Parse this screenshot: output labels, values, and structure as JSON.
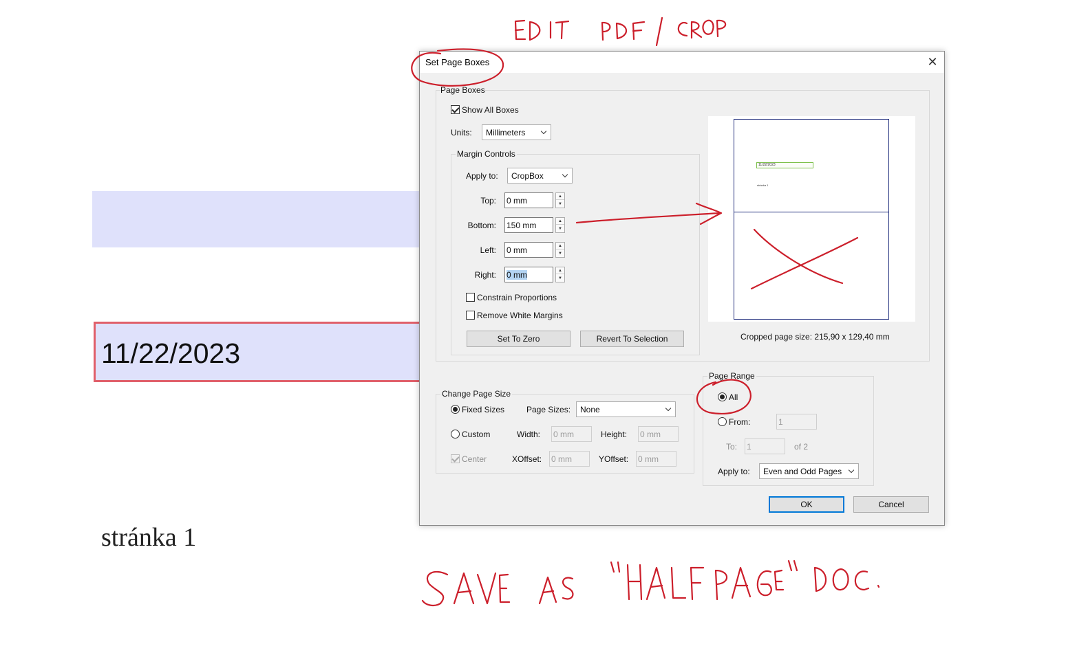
{
  "background_document": {
    "date_field_value": "11/22/2023",
    "page_label": "stránka 1"
  },
  "dialog": {
    "title": "Set Page Boxes",
    "close_glyph": "✕",
    "page_boxes": {
      "group_label": "Page Boxes",
      "show_all_boxes_label": "Show All Boxes",
      "show_all_boxes_checked": true,
      "units_label": "Units:",
      "units_value": "Millimeters",
      "margin_controls": {
        "group_label": "Margin Controls",
        "apply_to_label": "Apply to:",
        "apply_to_value": "CropBox",
        "top_label": "Top:",
        "top_value": "0 mm",
        "bottom_label": "Bottom:",
        "bottom_value": "150 mm",
        "left_label": "Left:",
        "left_value": "0 mm",
        "right_label": "Right:",
        "right_value": "0 mm",
        "constrain_label": "Constrain Proportions",
        "constrain_checked": false,
        "remove_white_label": "Remove White Margins",
        "remove_white_checked": false,
        "set_to_zero_label": "Set To Zero",
        "revert_label": "Revert To Selection"
      },
      "preview": {
        "mini_date": "11/22/2023",
        "mini_page": "stránka 1",
        "cropped_size_text": "Cropped page size: 215,90 x 129,40 mm"
      }
    },
    "change_page_size": {
      "group_label": "Change Page Size",
      "fixed_sizes_label": "Fixed Sizes",
      "fixed_selected": true,
      "page_sizes_label": "Page Sizes:",
      "page_sizes_value": "None",
      "custom_label": "Custom",
      "width_label": "Width:",
      "width_value": "0 mm",
      "height_label": "Height:",
      "height_value": "0 mm",
      "center_label": "Center",
      "xoffset_label": "XOffset:",
      "xoffset_value": "0 mm",
      "yoffset_label": "YOffset:",
      "yoffset_value": "0 mm"
    },
    "page_range": {
      "group_label": "Page Range",
      "all_label": "All",
      "all_selected": true,
      "from_label": "From:",
      "from_value": "1",
      "to_label": "To:",
      "to_value": "1",
      "of_text": "of 2",
      "apply_to_label": "Apply to:",
      "apply_to_value": "Even and Odd Pages"
    },
    "ok_label": "OK",
    "cancel_label": "Cancel"
  },
  "annotations": {
    "top_note": "EDIT PDF / CROP",
    "bottom_note": "SAVE AS \"HALF PAGE\" DOC.",
    "ink_color": "#cc1f2b"
  }
}
